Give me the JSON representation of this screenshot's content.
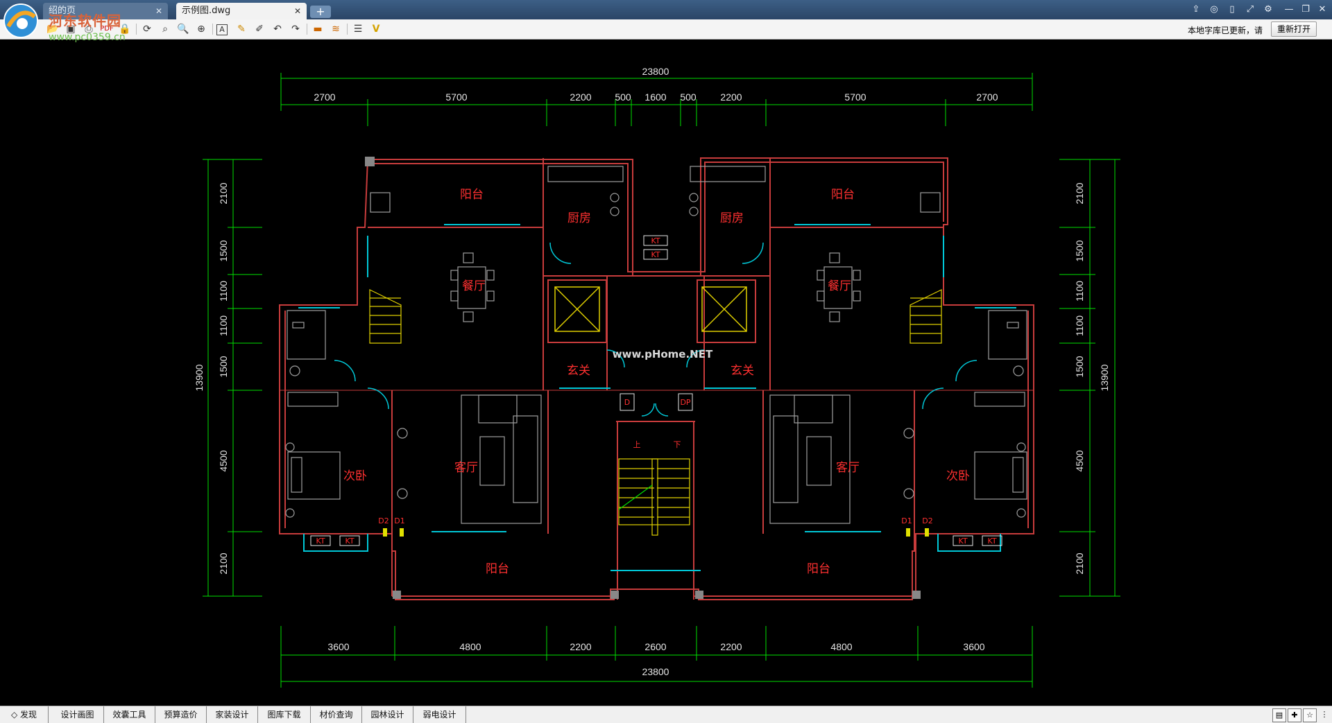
{
  "tabs": [
    {
      "label": "绍的页"
    },
    {
      "label": "示例图.dwg"
    }
  ],
  "watermark": {
    "text": "河东软件园",
    "url": "www.pc0359.cn"
  },
  "toolbar": {
    "icons": [
      "open-folder-icon",
      "save-icon",
      "print-icon",
      "pdf-icon",
      "lock-icon",
      "rotate-icon",
      "zoom-window-icon",
      "zoom-realtime-icon",
      "zoom-extents-icon",
      "text-icon",
      "pencil-icon",
      "pen-icon",
      "undo-icon",
      "redo-icon",
      "measure-icon",
      "layer-color-icon",
      "layers-icon",
      "check-icon"
    ],
    "notice": "本地字库已更新，请",
    "reopen_label": "重新打开"
  },
  "drawing": {
    "dims_top_overall": "23800",
    "dims_top": [
      "2700",
      "5700",
      "2200",
      "500",
      "1600",
      "500",
      "2200",
      "5700",
      "2700"
    ],
    "dims_bottom": [
      "3600",
      "4800",
      "2200",
      "2600",
      "2200",
      "4800",
      "3600"
    ],
    "dims_bottom_overall": "23800",
    "dims_left": [
      "2100",
      "1500",
      "1100",
      "1100",
      "1500",
      "4500",
      "2100"
    ],
    "dims_left_overall": "13900",
    "dims_right": [
      "2100",
      "1500",
      "1100",
      "1100",
      "1500",
      "4500",
      "2100"
    ],
    "dims_right_overall": "13900",
    "rooms": {
      "balcony": "阳台",
      "kitchen": "厨房",
      "dining": "餐厅",
      "foyer": "玄关",
      "living": "客厅",
      "bedroom2": "次卧"
    },
    "tags": {
      "kt": "KT",
      "d": "D",
      "dp": "DP",
      "d1": "D1",
      "d2": "D2",
      "up": "上",
      "down": "下"
    },
    "watermark_center": "www.pHome.NET"
  },
  "statusbar": {
    "items": [
      "发现",
      "设计画图",
      "效囊工具",
      "预算造价",
      "家装设计",
      "图库下载",
      "材价查询",
      "园林设计",
      "弱电设计"
    ]
  }
}
